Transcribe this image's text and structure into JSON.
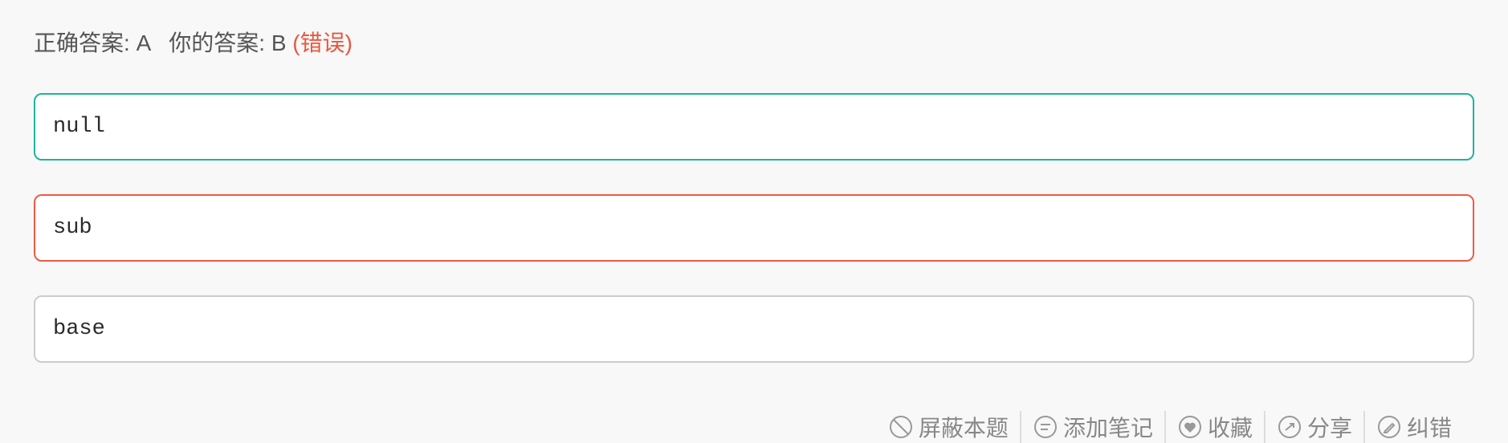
{
  "summary": {
    "correct_label": "正确答案: ",
    "correct_value": "A",
    "yours_label": "你的答案: ",
    "yours_value": "B",
    "verdict": "(错误)",
    "colors": {
      "verdict": "#e9573f"
    }
  },
  "options": [
    {
      "key": "A",
      "text": "null",
      "state": "correct",
      "border_color": "#1fb39e"
    },
    {
      "key": "B",
      "text": "sub",
      "state": "wrong",
      "border_color": "#ee5a45"
    },
    {
      "key": "C",
      "text": "base",
      "state": "neutral",
      "border_color": "#cccccc"
    }
  ],
  "toolbar": {
    "items": [
      {
        "label": "屏蔽本题",
        "icon": "block-icon"
      },
      {
        "label": "添加笔记",
        "icon": "note-icon"
      },
      {
        "label": "收藏",
        "icon": "favorite-icon"
      },
      {
        "label": "分享",
        "icon": "share-icon"
      },
      {
        "label": "纠错",
        "icon": "report-error-icon"
      }
    ]
  }
}
